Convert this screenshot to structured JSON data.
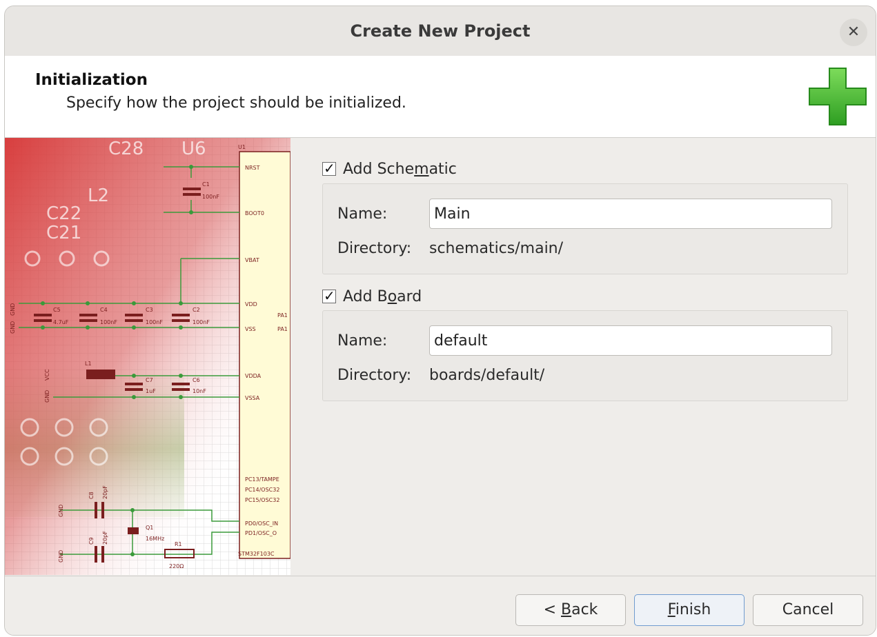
{
  "window": {
    "title": "Create New Project"
  },
  "header": {
    "title": "Initialization",
    "subtitle": "Specify how the project should be initialized."
  },
  "schematic": {
    "checkbox_pre": "Add Sche",
    "checkbox_mn": "m",
    "checkbox_post": "atic",
    "checked": true,
    "name_label": "Name:",
    "name_value": "Main",
    "dir_label": "Directory:",
    "dir_value": "schematics/main/"
  },
  "board": {
    "checkbox_pre": "Add B",
    "checkbox_mn": "o",
    "checkbox_post": "ard",
    "checked": true,
    "name_label": "Name:",
    "name_value": "default",
    "dir_label": "Directory:",
    "dir_value": "boards/default/"
  },
  "buttons": {
    "back_pre": "< ",
    "back_mn": "B",
    "back_post": "ack",
    "finish_mn": "F",
    "finish_post": "inish",
    "cancel": "Cancel"
  },
  "side_image": {
    "labels": [
      "C28",
      "U6",
      "L2",
      "C22",
      "C21",
      "U1",
      "NRST",
      "C1",
      "100nF",
      "BOOT0",
      "VBAT",
      "VDD",
      "VSS",
      "C5",
      "4.7uF",
      "C4",
      "100nF",
      "C3",
      "100nF",
      "C2",
      "100nF",
      "PA1",
      "PA1",
      "L1",
      "VCC",
      "GND",
      "C7",
      "1uF",
      "C6",
      "10nF",
      "VDDA",
      "VSSA",
      "GND",
      "PC13/TAMPE",
      "PC14/OSC32",
      "PC15/OSC32",
      "C8",
      "20pF",
      "GND",
      "Q1",
      "16MHz",
      "PD0/OSC_IN",
      "PD1/OSC_O",
      "C9",
      "20pF",
      "R1",
      "220Ω",
      "GND",
      "STM32F103C",
      "GND"
    ]
  },
  "colors": {
    "accent": "#6f9bcf",
    "plus": "#3fb62f"
  }
}
